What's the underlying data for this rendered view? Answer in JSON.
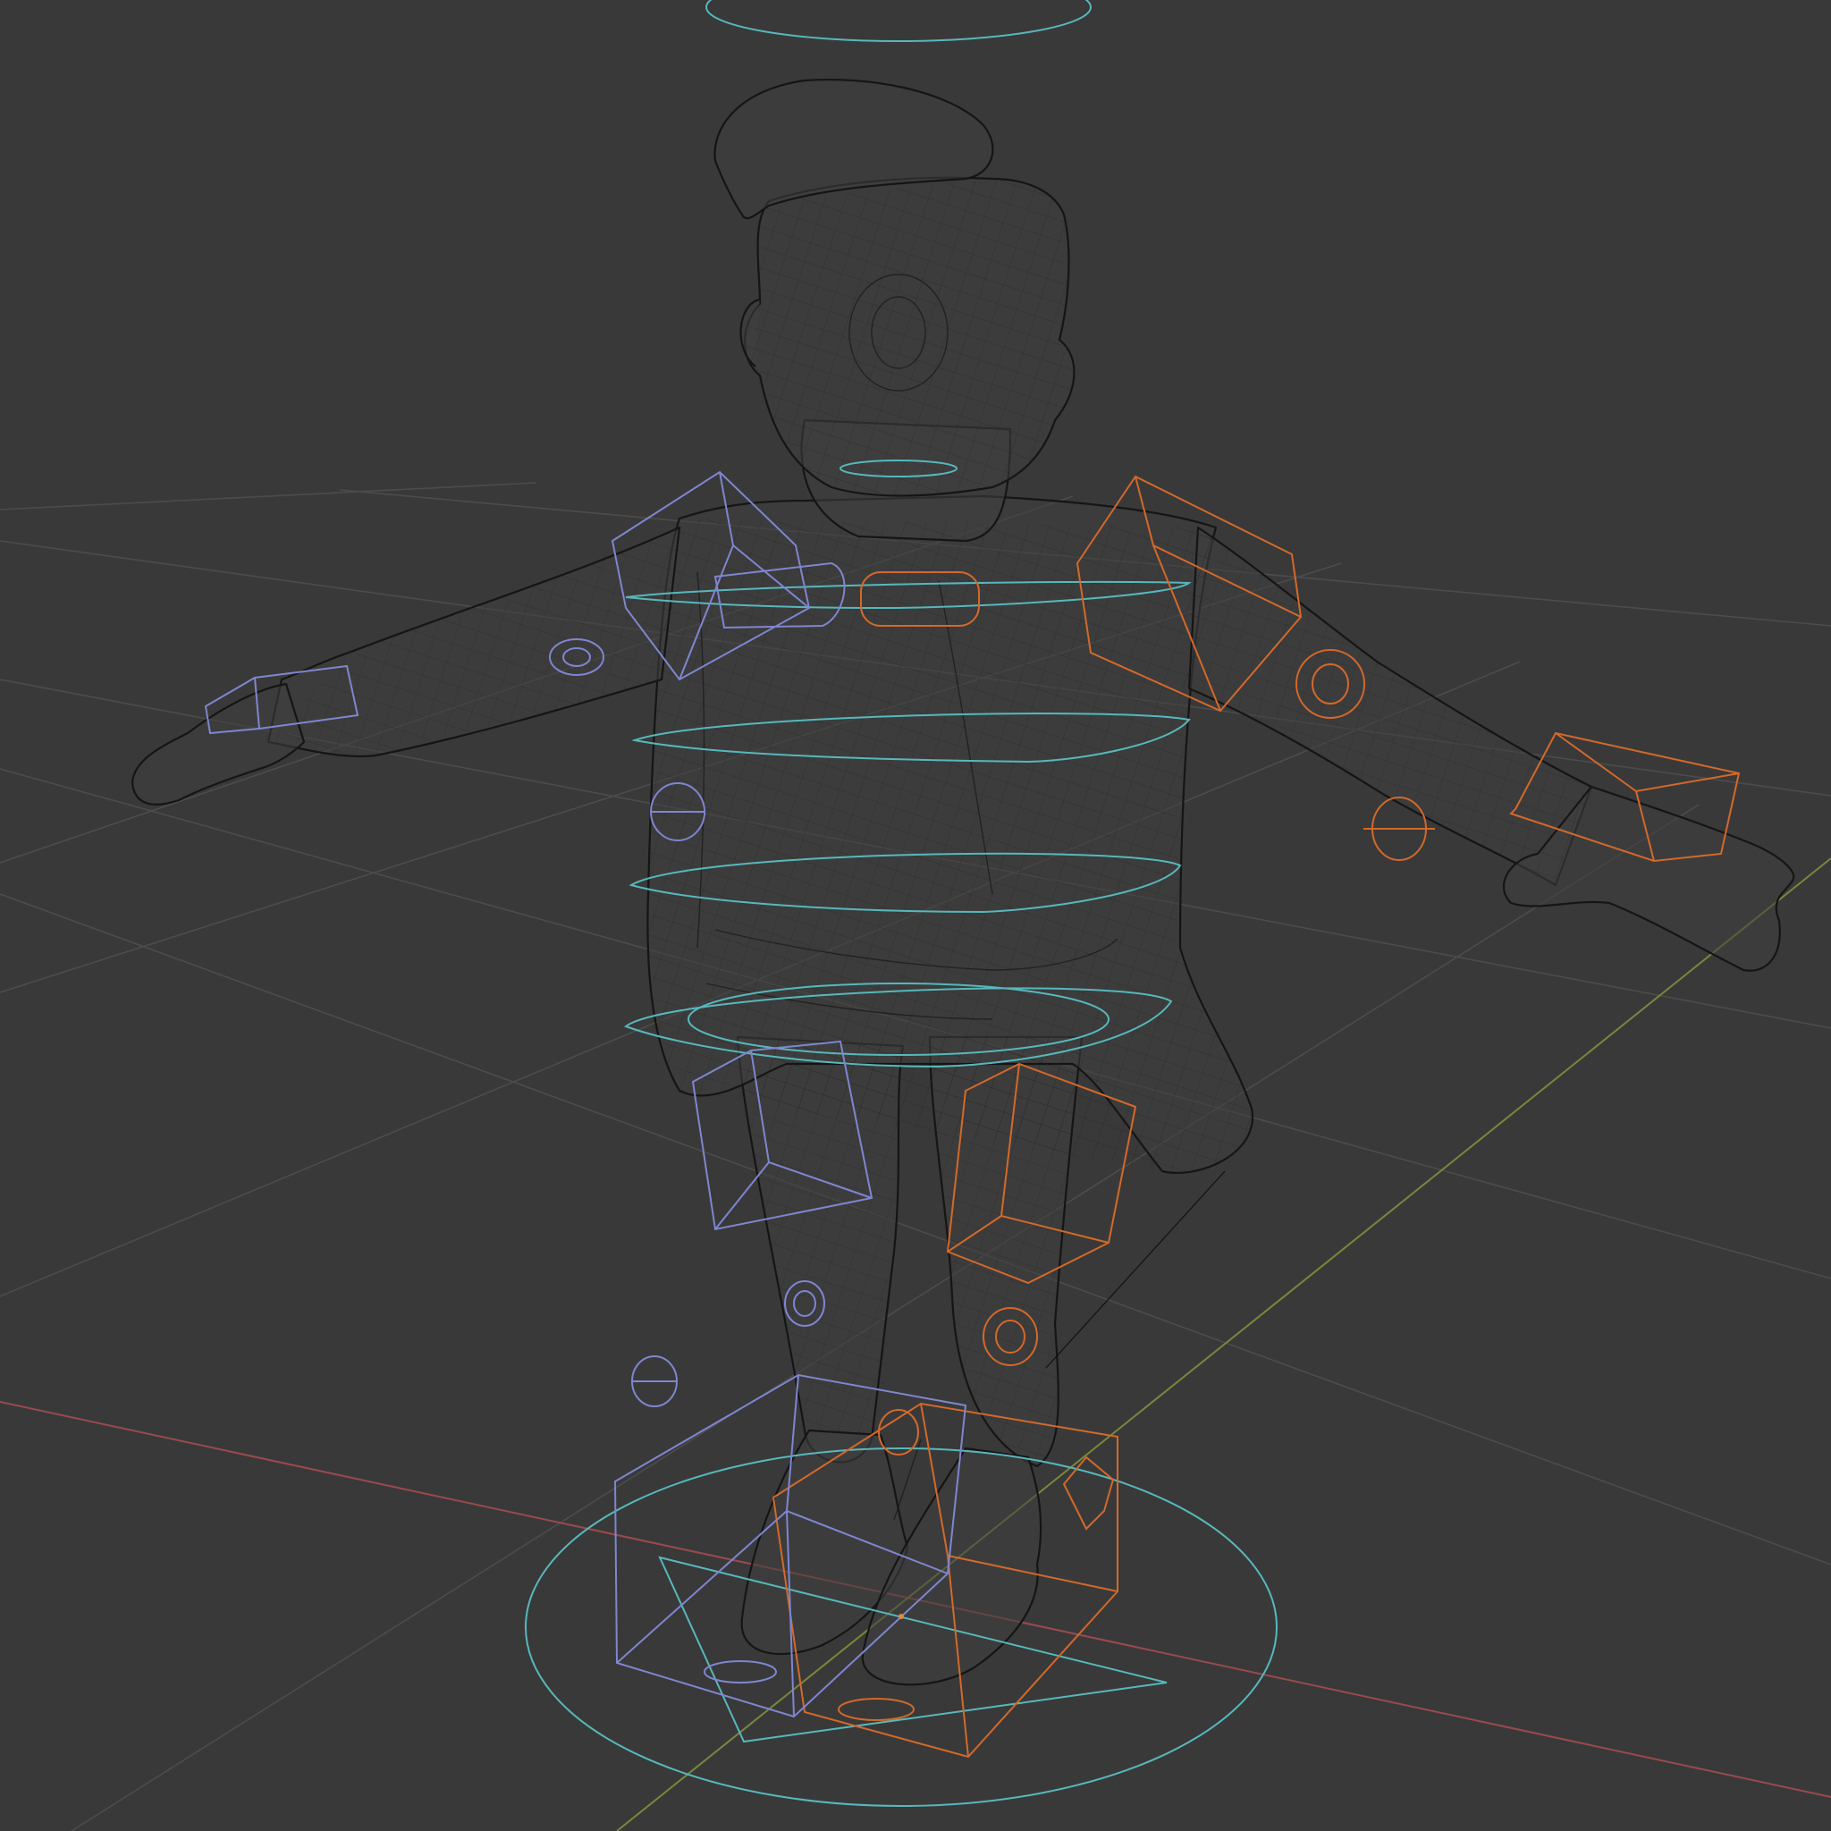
{
  "viewport": {
    "shading_mode": "wireframe",
    "background_color": "#393939",
    "grid_color": "#4c4c4c",
    "x_axis_color": "#9a4a4f",
    "y_axis_color": "#77893b",
    "mesh_wire_color": "#151515",
    "icons": [
      "character-mesh",
      "rig-control-shapes",
      "root-control-circle",
      "floor-grid"
    ]
  },
  "rig": {
    "control_colors": {
      "center": "#57b8bc",
      "left": "#d3692b",
      "right": "#7f86d0"
    }
  }
}
